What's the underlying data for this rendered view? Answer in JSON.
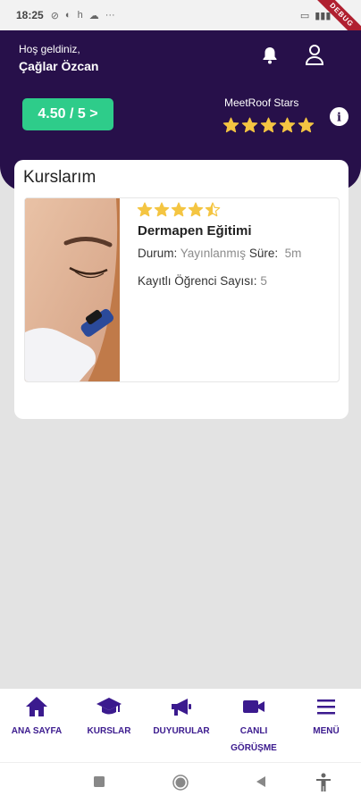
{
  "status_bar": {
    "time": "18:25",
    "left_icons": [
      "mute-icon",
      "whatsapp-icon",
      "h",
      "cloud-icon",
      "more-dots-icon"
    ],
    "left_glyphs": [
      "⊘",
      "◐",
      "h",
      "☁",
      "···"
    ],
    "right_icons": [
      "battery-saver-icon",
      "signal-icon",
      "wifi-icon"
    ],
    "right_glyphs": [
      "▭",
      "▮▮▮",
      "◠"
    ],
    "debug_label": "DEBUG"
  },
  "header": {
    "greeting": "Hoş geldiniz,",
    "user_name": "Çağlar Özcan",
    "rating_button": "4.50 / 5 >",
    "stars_title": "MeetRoof Stars",
    "stars_value": 5,
    "info_glyph": "i"
  },
  "courses": {
    "title": "Kurslarım",
    "items": [
      {
        "name": "Dermapen Eğitimi",
        "rating": 4.5,
        "status_label": "Durum:",
        "status_value": "Yayınlanmış",
        "duration_label": "Süre:",
        "duration_value": "5m",
        "students_label": "Kayıtlı Öğrenci Sayısı:",
        "students_value": "5"
      }
    ]
  },
  "nav": {
    "items": [
      {
        "label": "ANA SAYFA",
        "icon": "home-icon"
      },
      {
        "label": "KURSLAR",
        "icon": "graduation-cap-icon"
      },
      {
        "label": "DUYURULAR",
        "icon": "megaphone-icon"
      },
      {
        "label": "CANLI GÖRÜŞME",
        "icon": "video-camera-icon"
      },
      {
        "label": "MENÜ",
        "icon": "menu-icon"
      }
    ]
  },
  "colors": {
    "header_bg": "#27104a",
    "accent_green": "#2ecc8a",
    "nav_purple": "#3b1a8e",
    "star_yellow": "#f4c542"
  }
}
